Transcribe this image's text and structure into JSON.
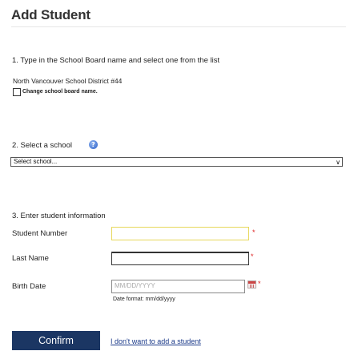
{
  "page": {
    "title": "Add Student"
  },
  "step1": {
    "heading": "1. Type in the School Board name and select one from the list",
    "board_name": "North Vancouver School District #44",
    "change_label": "Change school board name."
  },
  "step2": {
    "heading": "2. Select a school",
    "help_icon": "question-mark-icon",
    "select_value": "Select school..."
  },
  "step3": {
    "heading": "3. Enter student information",
    "student_number_label": "Student Number",
    "last_name_label": "Last Name",
    "birth_date_label": "Birth Date",
    "birth_date_placeholder": "MM/DD/YYYY",
    "date_format_hint": "Date format: mm/dd/yyyy",
    "required_marker": "*"
  },
  "actions": {
    "confirm_label": "Confirm",
    "cancel_link": "I don't want to add a student"
  },
  "colors": {
    "button_bg": "#1b3663",
    "required": "#dd2222",
    "highlight_border": "#e7d75a",
    "link": "#1b3a8a"
  }
}
